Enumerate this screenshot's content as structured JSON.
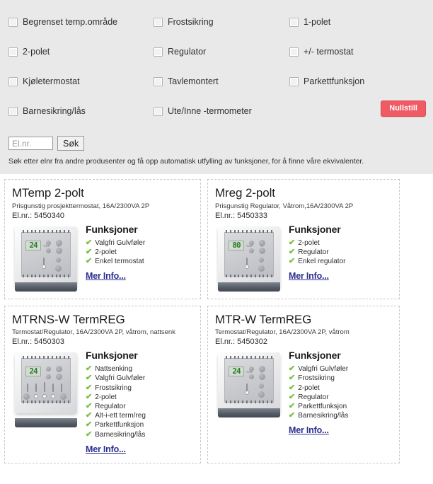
{
  "filters": {
    "rows": [
      [
        {
          "label": "Begrenset temp.område",
          "checked": false
        },
        {
          "label": "Frostsikring",
          "checked": false
        },
        {
          "label": "1-polet",
          "checked": false
        }
      ],
      [
        {
          "label": "2-polet",
          "checked": false
        },
        {
          "label": "Regulator",
          "checked": false
        },
        {
          "label": "+/- termostat",
          "checked": false
        }
      ],
      [
        {
          "label": "Kjøletermostat",
          "checked": false
        },
        {
          "label": "Tavlemontert",
          "checked": false
        },
        {
          "label": "Parkettfunksjon",
          "checked": false
        }
      ],
      [
        {
          "label": "Barnesikring/lås",
          "checked": false
        },
        {
          "label": "Ute/Inne -termometer",
          "checked": false
        }
      ]
    ],
    "reset_label": "Nullstill",
    "reset_color": "#ef5a63"
  },
  "search": {
    "placeholder": "El.nr.",
    "value": "",
    "button_label": "Søk",
    "help_text": "Søk etter elnr fra andre produsenter og få opp automatisk utfylling av funksjoner, for å finne våre ekvivalenter."
  },
  "products": [
    {
      "title": "MTemp 2-polt",
      "subtitle": "Prisgunstig prosjekttermostat, 16A/2300VA 2P",
      "elnr": "El.nr.: 5450340",
      "display_value": "24",
      "functions_heading": "Funksjoner",
      "functions": [
        "Valgfri Gulvføler",
        "2-polet",
        "Enkel termostat"
      ],
      "more_label": "Mer Info...",
      "has_sliders": false
    },
    {
      "title": "Mreg 2-polt",
      "subtitle": "Prisgunstig Regulator, Våtrom,16A/2300VA 2P",
      "elnr": "El.nr.: 5450333",
      "display_value": "80",
      "functions_heading": "Funksjoner",
      "functions": [
        "2-polet",
        "Regulator",
        "Enkel regulator"
      ],
      "more_label": "Mer Info...",
      "has_sliders": false
    },
    {
      "title": "MTRNS-W TermREG",
      "subtitle": "Termostat/Regulator, 16A/2300VA 2P, våtrom, nattsenk",
      "elnr": "El.nr.: 5450303",
      "display_value": "24",
      "functions_heading": "Funksjoner",
      "functions": [
        "Nattsenking",
        "Valgfri Gulvføler",
        "Frostsikring",
        "2-polet",
        "Regulator",
        "Alt-i-ett term/reg",
        "Parkettfunksjon",
        "Barnesikring/lås"
      ],
      "more_label": "Mer Info...",
      "has_sliders": true
    },
    {
      "title": "MTR-W TermREG",
      "subtitle": "Termostat/Regulator, 16A/2300VA 2P, våtrom",
      "elnr": "El.nr.: 5450302",
      "display_value": "24",
      "functions_heading": "Funksjoner",
      "functions": [
        "Valgfri Gulvføler",
        "Frostsikring",
        "2-polet",
        "Regulator",
        "Parkettfunksjon",
        "Barnesikring/lås"
      ],
      "more_label": "Mer Info...",
      "has_sliders": false
    }
  ],
  "icons": {
    "check": "✔",
    "checkbox": "checkbox-empty"
  }
}
